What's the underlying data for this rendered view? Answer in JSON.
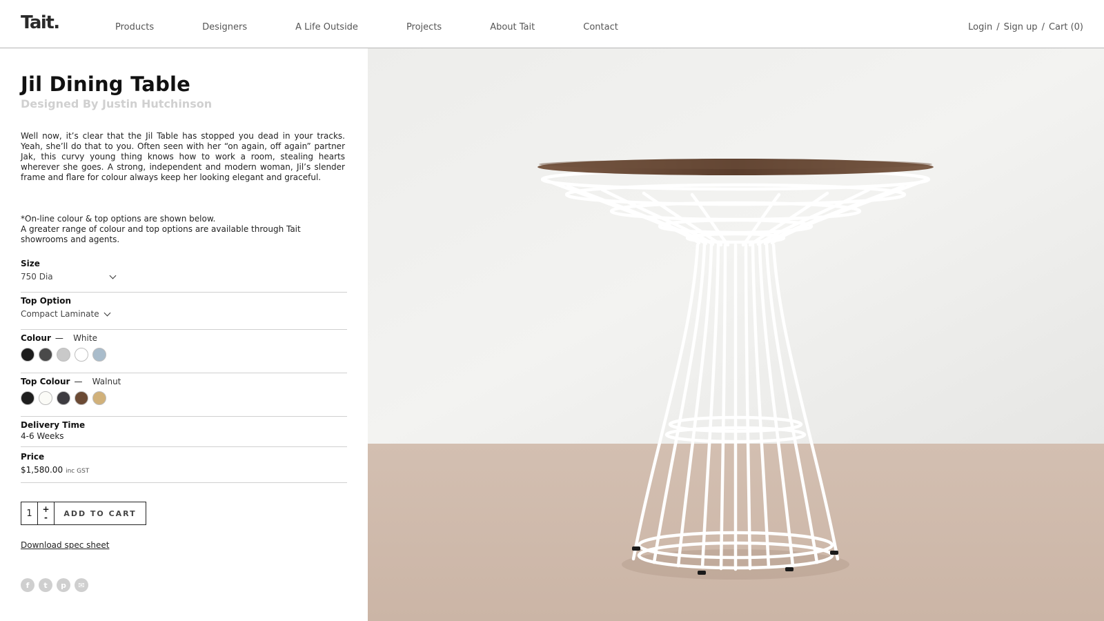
{
  "header": {
    "logo": "Tait.",
    "nav": [
      "Products",
      "Designers",
      "A Life Outside",
      "Projects",
      "About Tait",
      "Contact"
    ],
    "account": {
      "login": "Login",
      "sep1": "/",
      "signup": "Sign up",
      "sep2": "/",
      "cart": "Cart (0)"
    }
  },
  "product": {
    "title": "Jil Dining Table",
    "designer": "Designed By Justin Hutchinson",
    "description": "Well now, it’s clear that the Jil Table has stopped you dead in your tracks. Yeah, she’ll do that to you. Often seen with her “on again, off again” partner Jak, this curvy young thing knows how to work a room, stealing hearts wherever she goes. A strong, independent and modern woman, Jil’s slender frame and flare for colour always keep her looking elegant and graceful.",
    "note_line1": "*On-line colour & top options are shown below.",
    "note_line2": "A greater range of colour and top options are available through Tait showrooms and agents."
  },
  "options": {
    "size": {
      "label": "Size",
      "value": "750 Dia"
    },
    "top_option": {
      "label": "Top Option",
      "value": "Compact Laminate"
    },
    "colour": {
      "label": "Colour",
      "dash": "—",
      "selected": "White",
      "swatches": [
        "#1c1c1c",
        "#4a4a4a",
        "#c9c9c9",
        "#ffffff",
        "#a9bccb"
      ]
    },
    "top_colour": {
      "label": "Top Colour",
      "dash": "—",
      "selected": "Walnut",
      "swatches": [
        "#1e1e1e",
        "#fbfbf7",
        "#3d3b40",
        "#6b4a34",
        "#d1b17a"
      ]
    },
    "delivery": {
      "label": "Delivery Time",
      "value": "4-6 Weeks"
    },
    "price": {
      "label": "Price",
      "value": "$1,580.00",
      "tax": "inc GST"
    }
  },
  "cart": {
    "qty": "1",
    "plus": "+",
    "minus": "-",
    "add_label": "ADD TO CART"
  },
  "download_label": "Download spec sheet",
  "social": [
    {
      "icon": "facebook-icon",
      "glyph": "f"
    },
    {
      "icon": "twitter-icon",
      "glyph": "t"
    },
    {
      "icon": "pinterest-icon",
      "glyph": "p"
    },
    {
      "icon": "email-icon",
      "glyph": "✉"
    }
  ],
  "colors": {
    "accent": "#111111",
    "muted": "#d0d0d0",
    "divider": "#cfcfcf"
  }
}
